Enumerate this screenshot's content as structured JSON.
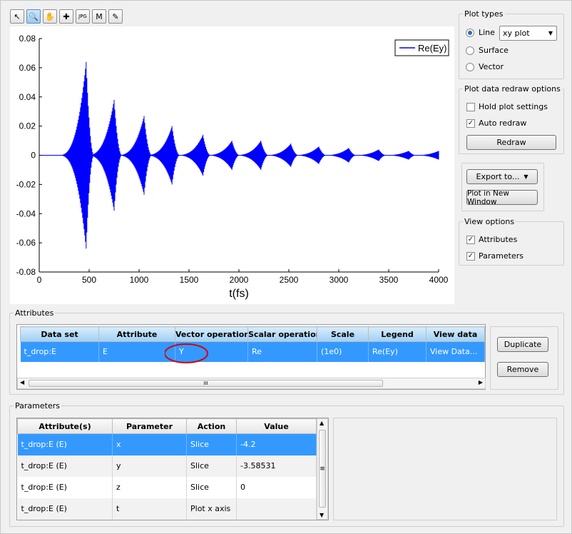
{
  "toolbar": {
    "tools": [
      {
        "name": "pointer-tool",
        "glyph": "↖",
        "active": false
      },
      {
        "name": "zoom-tool",
        "glyph": "🔍",
        "active": true
      },
      {
        "name": "pan-tool",
        "glyph": "✋",
        "active": false
      },
      {
        "name": "zoom-region-tool",
        "glyph": "✚",
        "active": false
      },
      {
        "name": "export-jpg-tool",
        "glyph": "JPG",
        "active": false
      },
      {
        "name": "export-matlab-tool",
        "glyph": "M",
        "active": false
      },
      {
        "name": "annotate-tool",
        "glyph": "✎",
        "active": false
      }
    ]
  },
  "plot_types": {
    "title": "Plot types",
    "options": [
      {
        "label": "Line",
        "checked": true
      },
      {
        "label": "Surface",
        "checked": false
      },
      {
        "label": "Vector",
        "checked": false
      }
    ],
    "line_style": "xy plot"
  },
  "redraw_options": {
    "title": "Plot data redraw options",
    "hold_label": "Hold plot settings",
    "hold_checked": false,
    "auto_label": "Auto redraw",
    "auto_checked": true,
    "redraw_button": "Redraw"
  },
  "export": {
    "export_button": "Export to...",
    "new_window_button": "Plot in New Window"
  },
  "view_options": {
    "title": "View options",
    "attributes_label": "Attributes",
    "attributes_checked": true,
    "parameters_label": "Parameters",
    "parameters_checked": true
  },
  "chart_data": {
    "type": "line",
    "xlabel": "t(fs)",
    "ylabel": "",
    "xlim": [
      0,
      4000
    ],
    "ylim": [
      -0.08,
      0.08
    ],
    "xticks": [
      "0",
      "500",
      "1000",
      "1500",
      "2000",
      "2500",
      "3000",
      "3500",
      "4000"
    ],
    "yticks": [
      "0.08",
      "0.06",
      "0.04",
      "0.02",
      "0",
      "-0.02",
      "-0.04",
      "-0.06",
      "-0.08"
    ],
    "legend_position": "top-right",
    "series": [
      {
        "name": "Re(Ey)",
        "color": "#0000ff",
        "bursts": [
          {
            "t": 470,
            "amp": 0.064
          },
          {
            "t": 750,
            "amp": 0.038
          },
          {
            "t": 1050,
            "amp": 0.027
          },
          {
            "t": 1330,
            "amp": 0.02
          },
          {
            "t": 1640,
            "amp": 0.014
          },
          {
            "t": 1930,
            "amp": 0.01
          },
          {
            "t": 2220,
            "amp": 0.01
          },
          {
            "t": 2520,
            "amp": 0.008
          },
          {
            "t": 2800,
            "amp": 0.006
          },
          {
            "t": 3100,
            "amp": 0.005
          },
          {
            "t": 3400,
            "amp": 0.004
          },
          {
            "t": 3700,
            "amp": 0.003
          },
          {
            "t": 4000,
            "amp": 0.003
          }
        ]
      }
    ]
  },
  "attributes": {
    "title": "Attributes",
    "columns": [
      "Data set",
      "Attribute",
      "Vector operation",
      "Scalar operation",
      "Scale",
      "Legend",
      "View data"
    ],
    "rows": [
      [
        "t_drop:E",
        "E",
        "Y",
        "Re",
        "(1e0)",
        "Re(Ey)",
        "View Data..."
      ]
    ],
    "duplicate_button": "Duplicate",
    "remove_button": "Remove",
    "scroll_grip": "III"
  },
  "parameters": {
    "title": "Parameters",
    "columns": [
      "Attribute(s)",
      "Parameter",
      "Action",
      "Value"
    ],
    "rows": [
      [
        "t_drop:E (E)",
        "x",
        "Slice",
        "-4.2"
      ],
      [
        "t_drop:E (E)",
        "y",
        "Slice",
        "-3.58531"
      ],
      [
        "t_drop:E (E)",
        "z",
        "Slice",
        "0"
      ],
      [
        "t_drop:E (E)",
        "t",
        "Plot x axis",
        ""
      ]
    ],
    "scroll_grip": "≡"
  }
}
